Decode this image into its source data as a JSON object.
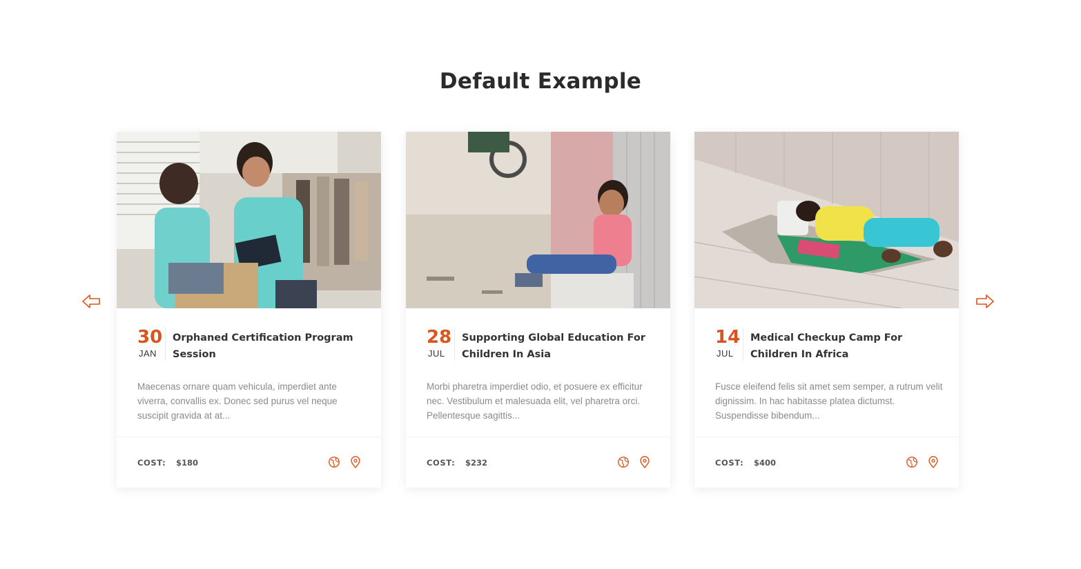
{
  "section": {
    "title": "Default Example"
  },
  "colors": {
    "accent": "#d9541e",
    "text_dark": "#333333",
    "text_muted": "#8a8a8a"
  },
  "icons": {
    "prev": "arrow-left-icon",
    "next": "arrow-right-icon",
    "globe": "globe-icon",
    "location": "map-pin-icon"
  },
  "events": [
    {
      "image": "volunteers-photo",
      "day": "30",
      "month": "JAN",
      "title": "Orphaned Certification Program Session",
      "description": "Maecenas ornare quam vehicula, imperdiet ante viverra, convallis ex. Donec sed purus vel neque suscipit gravida at at...",
      "cost_label": "COST:",
      "cost": "$180"
    },
    {
      "image": "child-sitting-photo",
      "day": "28",
      "month": "JUL",
      "title": "Supporting Global Education For Children In Asia",
      "description": "Morbi pharetra imperdiet odio, et posuere ex efficitur nec. Vestibulum et malesuada elit, vel pharetra orci. Pellentesque sagittis...",
      "cost_label": "COST:",
      "cost": "$232"
    },
    {
      "image": "child-sleeping-photo",
      "day": "14",
      "month": "JUL",
      "title": "Medical Checkup Camp For Children In Africa",
      "description": "Fusce eleifend felis sit amet sem semper, a rutrum velit dignissim. In hac habitasse platea dictumst. Suspendisse bibendum...",
      "cost_label": "COST:",
      "cost": "$400"
    }
  ]
}
